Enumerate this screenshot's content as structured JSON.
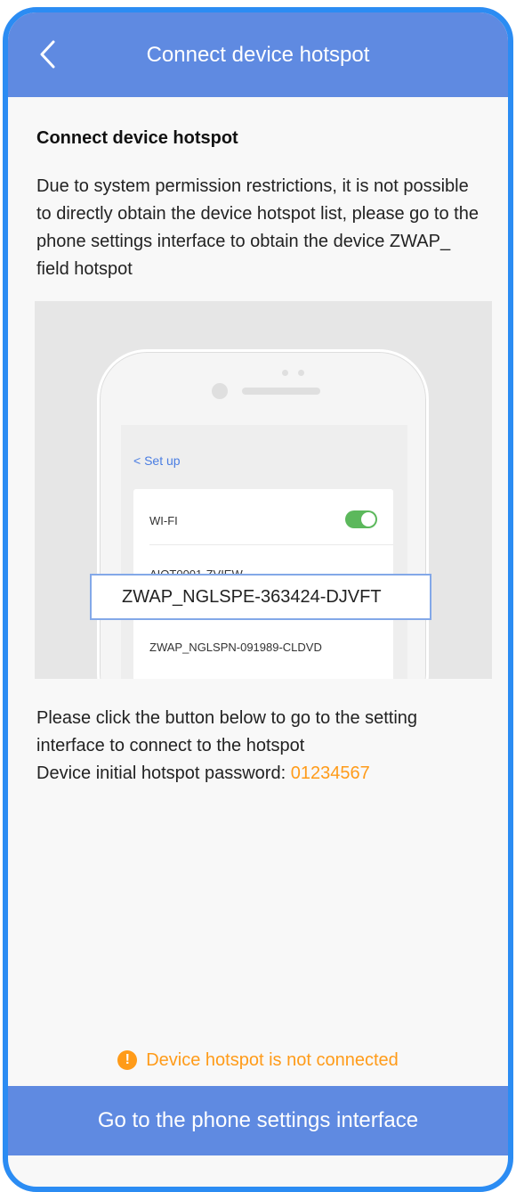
{
  "header": {
    "title": "Connect device hotspot",
    "back_icon": "chevron-left-icon"
  },
  "content": {
    "section_title": "Connect device hotspot",
    "description": "Due to system permission restrictions, it is not possible to directly obtain the device hotspot list, please go to the phone settings interface to obtain the device ZWAP_ field hotspot",
    "illustration": {
      "back_label": "< Set up",
      "wifi_label": "WI-FI",
      "wifi_enabled": true,
      "networks": [
        "AIOT0001-ZVIEW",
        "ZWAP_NGLSPE-363424-DJVFT",
        "ZWAP_NGLSPN-091989-CLDVD"
      ],
      "highlighted_network": "ZWAP_NGLSPE-363424-DJVFT"
    },
    "instruction_line_1": "Please click the button below to go to the setting interface to connect to the hotspot",
    "password_label": "Device initial hotspot password: ",
    "password_value": "01234567"
  },
  "status": {
    "warning_icon": "exclamation-circle-icon",
    "warning_text": "Device hotspot is not connected"
  },
  "actions": {
    "settings_button_label": "Go to the phone settings interface"
  },
  "colors": {
    "accent": "#5F8AE1",
    "warning": "#FF9B19",
    "toggle_on": "#5CB85C",
    "frame": "#2B8CF3"
  }
}
